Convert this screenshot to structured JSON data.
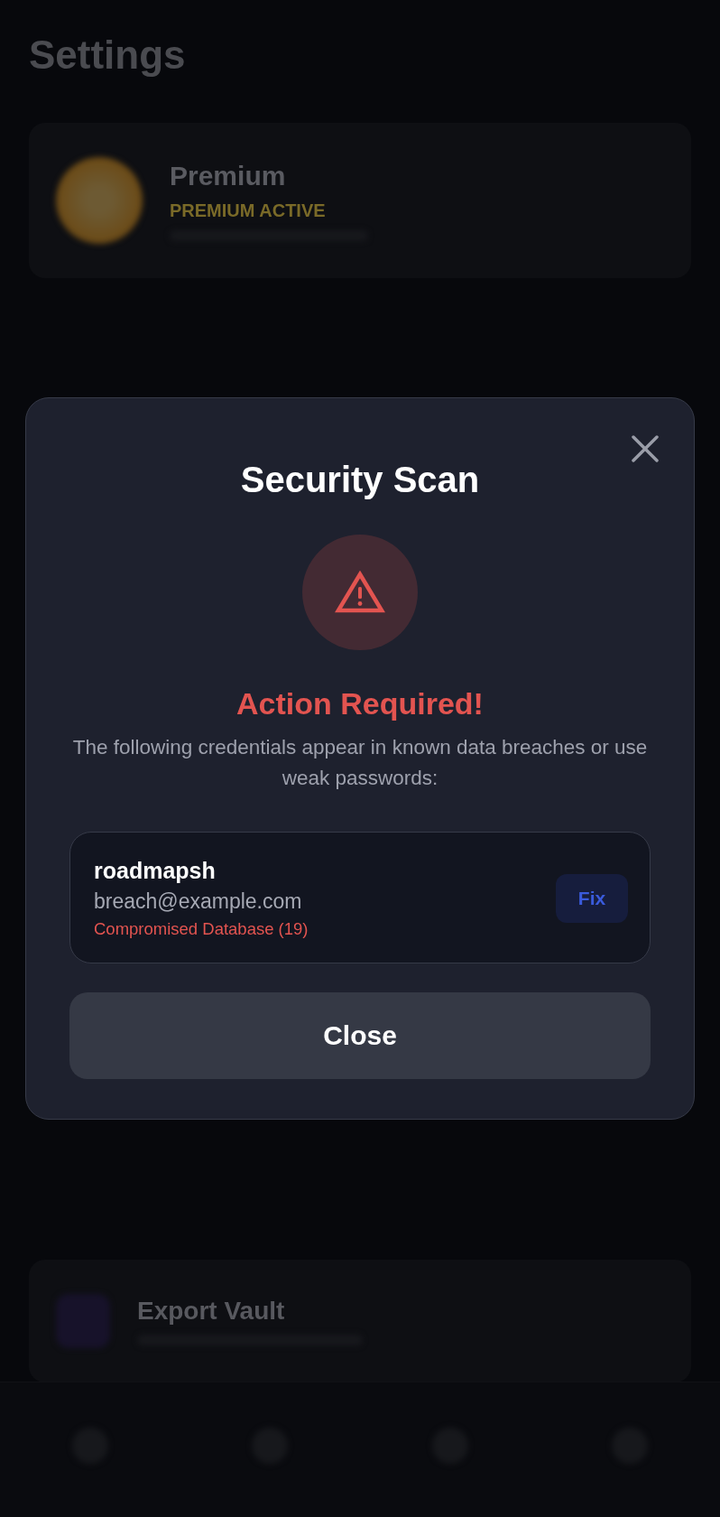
{
  "background": {
    "title": "Settings",
    "profile": {
      "name": "Premium",
      "status": "PREMIUM ACTIVE"
    },
    "vault_action": {
      "title": "Export Vault"
    }
  },
  "dialog": {
    "title": "Security Scan",
    "heading": "Action Required!",
    "description": "The following credentials appear in known data breaches or use weak passwords:",
    "credentials": [
      {
        "name": "roadmapsh",
        "email": "breach@example.com",
        "issue": "Compromised Database (19)",
        "action": "Fix"
      }
    ],
    "close_button": "Close"
  }
}
